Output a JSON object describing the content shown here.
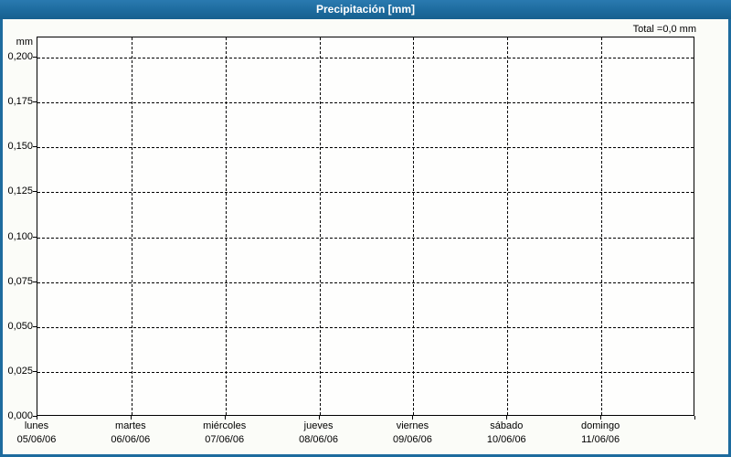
{
  "window": {
    "title": "Precipitación [mm]",
    "titlebar_color": "#1d6b9e",
    "border_color": "#1d6b9e",
    "background_color": "#fbfcf8"
  },
  "summary": {
    "total_label": "Total =0,0 mm"
  },
  "chart_data": {
    "type": "bar",
    "title": "Precipitación [mm]",
    "xlabel": "",
    "ylabel": "mm",
    "total_annotation": "Total =0,0 mm",
    "categories": [
      {
        "day": "lunes",
        "date": "05/06/06"
      },
      {
        "day": "martes",
        "date": "06/06/06"
      },
      {
        "day": "miércoles",
        "date": "07/06/06"
      },
      {
        "day": "jueves",
        "date": "08/06/06"
      },
      {
        "day": "viernes",
        "date": "09/06/06"
      },
      {
        "day": "sábado",
        "date": "10/06/06"
      },
      {
        "day": "domingo",
        "date": "11/06/06"
      }
    ],
    "values": [
      0,
      0,
      0,
      0,
      0,
      0,
      0
    ],
    "ylim": [
      0,
      0.2112
    ],
    "yticks": [
      {
        "value": 0.2,
        "label": "0,200"
      },
      {
        "value": 0.175,
        "label": "0,175"
      },
      {
        "value": 0.15,
        "label": "0,150"
      },
      {
        "value": 0.125,
        "label": "0,125"
      },
      {
        "value": 0.1,
        "label": "0,100"
      },
      {
        "value": 0.075,
        "label": "0,075"
      },
      {
        "value": 0.05,
        "label": "0,050"
      },
      {
        "value": 0.025,
        "label": "0,025"
      },
      {
        "value": 0.0,
        "label": "0,000"
      }
    ],
    "grid": {
      "horizontal": "dashed",
      "vertical": "dashed"
    },
    "legend": null
  }
}
